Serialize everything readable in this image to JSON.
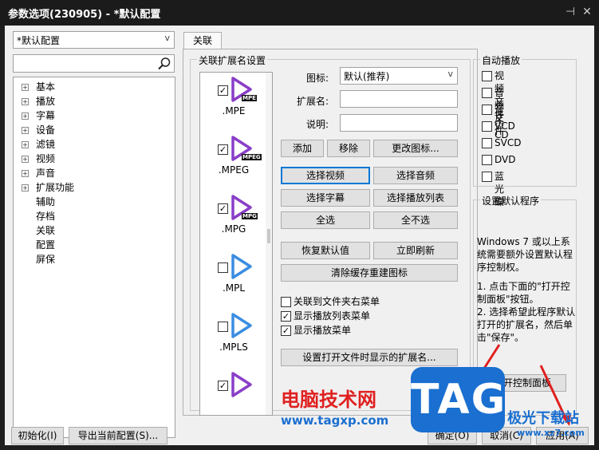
{
  "window": {
    "title": "参数选项(230905) - *默认配置",
    "pin_icon": "pin-icon",
    "close_icon": "close-icon"
  },
  "sidebar": {
    "preset": "*默认配置",
    "search_placeholder": "",
    "tree": [
      {
        "label": "基本",
        "expandable": true
      },
      {
        "label": "播放",
        "expandable": true
      },
      {
        "label": "字幕",
        "expandable": true
      },
      {
        "label": "设备",
        "expandable": true
      },
      {
        "label": "滤镜",
        "expandable": true
      },
      {
        "label": "视频",
        "expandable": true
      },
      {
        "label": "声音",
        "expandable": true
      },
      {
        "label": "扩展功能",
        "expandable": true
      },
      {
        "label": "辅助",
        "expandable": false
      },
      {
        "label": "存档",
        "expandable": false
      },
      {
        "label": "关联",
        "expandable": false
      },
      {
        "label": "配置",
        "expandable": false
      },
      {
        "label": "屏保",
        "expandable": false
      }
    ]
  },
  "tab": {
    "label": "关联"
  },
  "ext_group": {
    "title": "关联扩展名设置",
    "items": [
      {
        "name": ".MPE",
        "checked": true,
        "badge": "MPE"
      },
      {
        "name": ".MPEG",
        "checked": true,
        "badge": "MPEG"
      },
      {
        "name": ".MPG",
        "checked": true,
        "badge": "MPG"
      },
      {
        "name": ".MPL",
        "checked": false,
        "badge": ""
      },
      {
        "name": ".MPLS",
        "checked": false,
        "badge": ""
      }
    ],
    "icon_label": "图标:",
    "icon_value": "默认(推荐)",
    "ext_label": "扩展名:",
    "ext_value": "",
    "desc_label": "说明:",
    "desc_value": "",
    "add": "添加",
    "remove": "移除",
    "change_icon": "更改图标...",
    "select_video": "选择视频",
    "select_audio": "选择音频",
    "select_subtitle": "选择字幕",
    "select_playlist": "选择播放列表",
    "select_all": "全选",
    "select_none": "全不选",
    "restore_default": "恢复默认值",
    "refresh_now": "立即刷新",
    "clear_cache": "清除缓存重建图标",
    "menu_folder": "关联到文件夹右菜单",
    "menu_folder_checked": false,
    "show_playlist_menu": "显示播放列表菜单",
    "show_playlist_menu_checked": true,
    "show_play_menu": "显示播放菜单",
    "show_play_menu_checked": true,
    "set_ext_button": "设置打开文件时显示的扩展名..."
  },
  "autoplay": {
    "title": "自动播放",
    "items": [
      {
        "label": "视频文件",
        "checked": false
      },
      {
        "label": "音频文件",
        "checked": false
      },
      {
        "label": "音乐CD",
        "checked": false
      },
      {
        "label": "VCD",
        "checked": false
      },
      {
        "label": "SVCD",
        "checked": false
      },
      {
        "label": "DVD",
        "checked": false
      },
      {
        "label": "蓝光碟",
        "checked": false
      }
    ]
  },
  "default_program": {
    "title": "设置默认程序",
    "text1": "Windows 7 或以上系统需要额外设置默认程序控制权。",
    "text2": "1. 点击下面的\"打开控制面板\"按钮。",
    "text3": "2. 选择希望此程序默认打开的扩展名，然后单击\"保存\"。",
    "button": "打开控制面板"
  },
  "footer": {
    "init": "初始化(I)",
    "export": "导出当前配置(S)...",
    "ok": "确定(O)",
    "cancel": "取消(C)",
    "apply": "应用(A)"
  },
  "watermark": {
    "site_cn": "电脑技术网",
    "site_url": "www.tagxp.com",
    "badge": "TAG",
    "slogan": "极光下载站",
    "slogan_url": "www.xz7.com"
  },
  "colors": {
    "play_purple": "#8a3ec8",
    "play_blue": "#3a8de0",
    "watermark_red": "#e02020",
    "tag_blue": "#1a6fd0"
  }
}
